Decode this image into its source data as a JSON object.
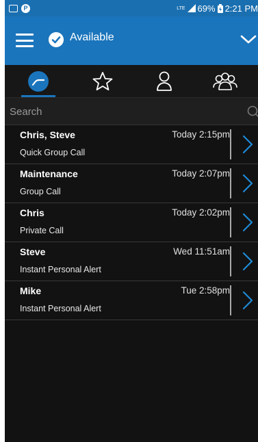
{
  "status_bar": {
    "lte": "LTE",
    "battery": "69%",
    "time": "2:21 PM"
  },
  "app_bar": {
    "presence": "Available"
  },
  "tabs": [
    {
      "name": "recent",
      "icon": "history-icon",
      "selected": true
    },
    {
      "name": "favorites",
      "icon": "star-icon",
      "selected": false
    },
    {
      "name": "contacts",
      "icon": "person-icon",
      "selected": false
    },
    {
      "name": "groups",
      "icon": "group-icon",
      "selected": false
    }
  ],
  "search": {
    "placeholder": "Search"
  },
  "history": [
    {
      "name": "Chris, Steve",
      "type": "Quick Group Call",
      "time": "Today 2:15pm"
    },
    {
      "name": "Maintenance",
      "type": "Group Call",
      "time": "Today 2:07pm"
    },
    {
      "name": "Chris",
      "type": "Private Call",
      "time": "Today 2:02pm"
    },
    {
      "name": "Steve",
      "type": "Instant Personal Alert",
      "time": "Wed 11:51am"
    },
    {
      "name": "Mike",
      "type": "Instant Personal Alert",
      "time": "Tue 2:58pm"
    }
  ],
  "colors": {
    "accent": "#1b75bc",
    "background": "#121212",
    "arrow": "#1e8ad6"
  }
}
